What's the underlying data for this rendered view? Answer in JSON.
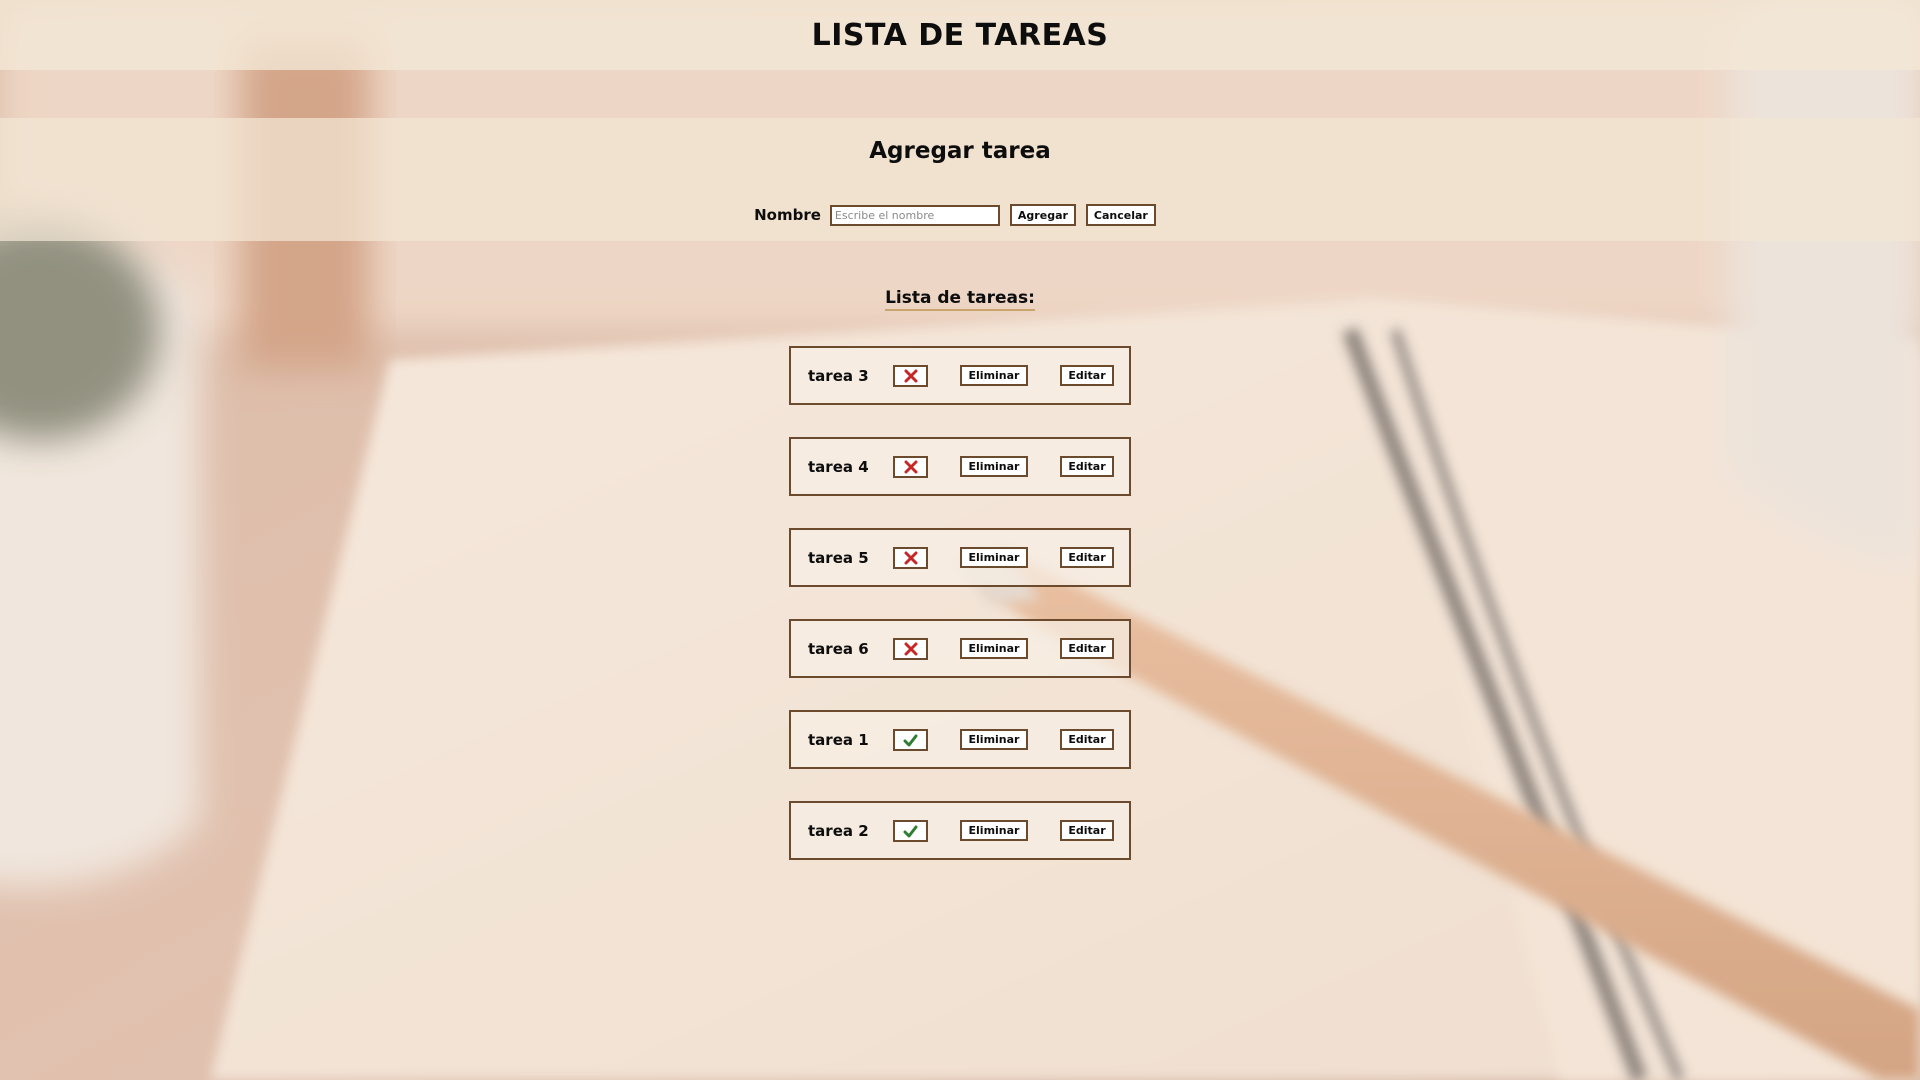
{
  "header": {
    "title": "LISTA DE TAREAS"
  },
  "add_task": {
    "heading": "Agregar tarea",
    "name_label": "Nombre",
    "name_placeholder": "Escribe el nombre",
    "add_label": "Agregar",
    "cancel_label": "Cancelar"
  },
  "task_list": {
    "heading": "Lista de tareas:",
    "tasks": [
      {
        "name": "tarea 3",
        "done": false,
        "delete_label": "Eliminar",
        "edit_label": "Editar"
      },
      {
        "name": "tarea 4",
        "done": false,
        "delete_label": "Eliminar",
        "edit_label": "Editar"
      },
      {
        "name": "tarea 5",
        "done": false,
        "delete_label": "Eliminar",
        "edit_label": "Editar"
      },
      {
        "name": "tarea 6",
        "done": false,
        "delete_label": "Eliminar",
        "edit_label": "Editar"
      },
      {
        "name": "tarea 1",
        "done": true,
        "delete_label": "Eliminar",
        "edit_label": "Editar"
      },
      {
        "name": "tarea 2",
        "done": true,
        "delete_label": "Eliminar",
        "edit_label": "Editar"
      }
    ]
  },
  "icons": {
    "not_done": "red-x-icon",
    "done": "green-check-icon"
  },
  "colors": {
    "border": "#6b4a2e",
    "not_done": "#c62828",
    "done": "#2e7d32",
    "heading_underline": "#c9a46f"
  }
}
